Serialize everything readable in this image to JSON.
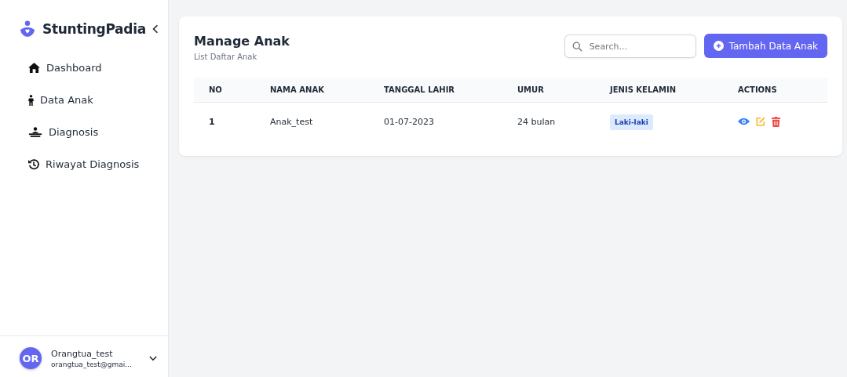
{
  "brand": {
    "name": "StuntingPadia"
  },
  "sidebar": {
    "items": [
      {
        "label": "Dashboard"
      },
      {
        "label": "Data Anak"
      },
      {
        "label": "Diagnosis"
      },
      {
        "label": "Riwayat Diagnosis"
      }
    ]
  },
  "user": {
    "initials": "OR",
    "name": "Orangtua_test",
    "email": "orangtua_test@gmai..."
  },
  "page": {
    "title": "Manage Anak",
    "subtitle": "List Daftar Anak"
  },
  "search": {
    "placeholder": "Search..."
  },
  "add_button": {
    "label": "Tambah Data Anak"
  },
  "table": {
    "columns": [
      "NO",
      "NAMA ANAK",
      "TANGGAL LAHIR",
      "UMUR",
      "JENIS KELAMIN",
      "ACTIONS"
    ],
    "rows": [
      {
        "no": "1",
        "name": "Anak_test",
        "birth_date": "01-07-2023",
        "age": "24 bulan",
        "gender": "Laki-laki"
      }
    ]
  }
}
